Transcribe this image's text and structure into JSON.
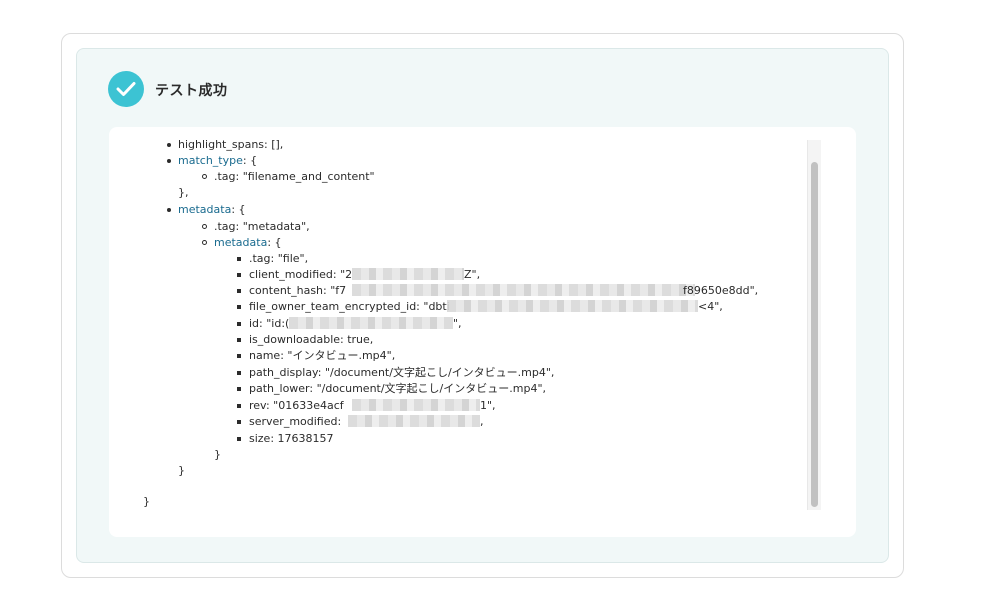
{
  "status": {
    "title": "テスト成功",
    "icon": "check-icon",
    "accent": "#3cc3d3"
  },
  "code": {
    "highlight_spans": "highlight_spans: [],",
    "match_type_key": "match_type",
    "match_type_open": ": {",
    "match_type_tag": ".tag: \"filename_and_content\"",
    "match_type_close": "},",
    "metadata_key": "metadata",
    "metadata_open": ": {",
    "metadata_tag": ".tag: \"metadata\",",
    "inner_metadata_key": "metadata",
    "inner_metadata_open": ": {",
    "file_tag": ".tag: \"file\",",
    "client_modified_a": "client_modified: \"2",
    "client_modified_b": "Z\",",
    "content_hash_a": "content_hash: \"f7",
    "content_hash_b": "f89650e8dd\",",
    "owner_team_a": "file_owner_team_encrypted_id: \"dbti",
    "owner_team_b": "<4\",",
    "id_a": "id: \"id:(",
    "id_b": "\",",
    "is_downloadable": "is_downloadable: true,",
    "name": "name: \"インタビュー.mp4\",",
    "path_display": "path_display: \"/document/文字起こし/インタビュー.mp4\",",
    "path_lower": "path_lower: \"/document/文字起こし/インタビュー.mp4\",",
    "rev_a": "rev: \"01633e4acf",
    "rev_b": "1\",",
    "server_modified_a": "server_modified:",
    "server_modified_b": ",",
    "size": "size: 17638157",
    "close_inner": "}",
    "close_metadata": "}",
    "close_root": "}"
  }
}
